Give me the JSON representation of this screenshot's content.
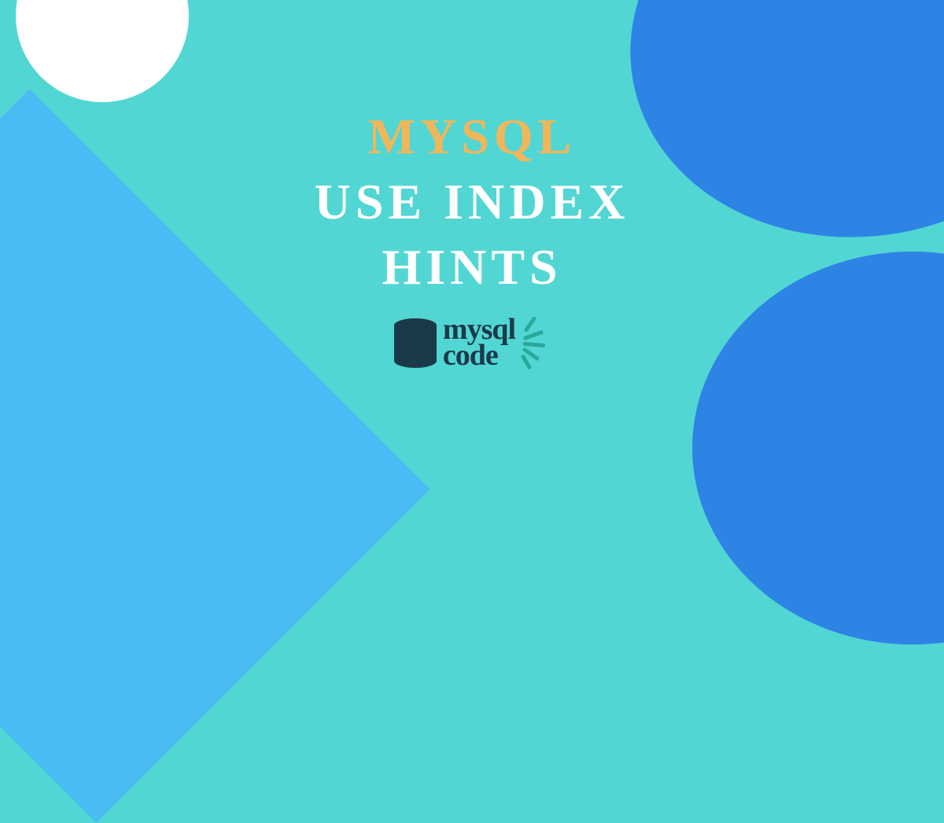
{
  "title": {
    "line1": "MYSQL",
    "line2": "USE INDEX",
    "line3": "HINTS"
  },
  "logo": {
    "word1": "mysql",
    "word2": "code"
  },
  "colors": {
    "bg": "#52d6d3",
    "accent": "#f2b65a",
    "white": "#ffffff",
    "blue_mid": "#4abcf3",
    "blue_dark": "#2d84e4",
    "logo_dark": "#1a3a4a",
    "logo_teal": "#2aa89a"
  }
}
